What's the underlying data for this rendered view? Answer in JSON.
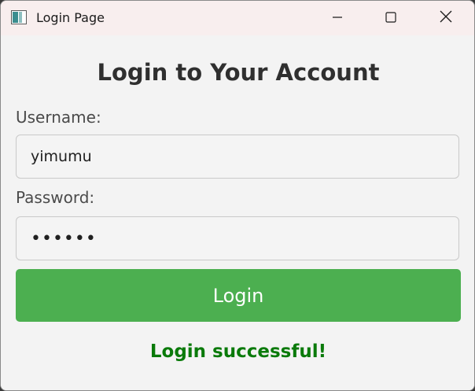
{
  "window": {
    "title": "Login Page",
    "controls": {
      "minimize_icon": "minimize-icon",
      "maximize_icon": "maximize-icon",
      "close_icon": "close-icon"
    }
  },
  "form": {
    "heading": "Login to Your Account",
    "username_label": "Username:",
    "username_value": "yimumu",
    "password_label": "Password:",
    "password_value": "••••••",
    "submit_label": "Login"
  },
  "status": {
    "message": "Login successful!",
    "color": "#0a7a0a"
  },
  "colors": {
    "accent": "#4caf50",
    "titlebar": "#f8eeee",
    "background": "#f3f3f3"
  }
}
